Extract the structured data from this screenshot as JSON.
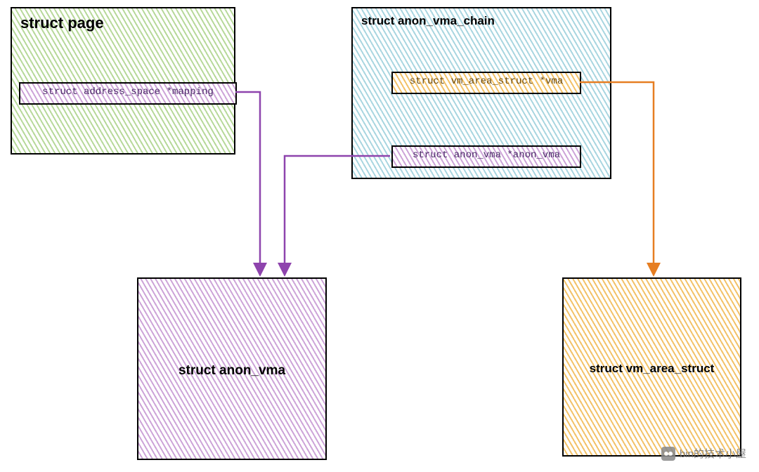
{
  "boxes": {
    "page": {
      "title": "struct page",
      "field_mapping": "struct address_space *mapping"
    },
    "avc": {
      "title": "struct anon_vma_chain",
      "field_vma": "struct vm_area_struct *vma",
      "field_anon": "struct anon_vma *anon_vma"
    },
    "anon_vma": {
      "label": "struct anon_vma"
    },
    "vma_struct": {
      "label": "struct vm_area_struct"
    }
  },
  "watermark": "bin的技术小屋"
}
